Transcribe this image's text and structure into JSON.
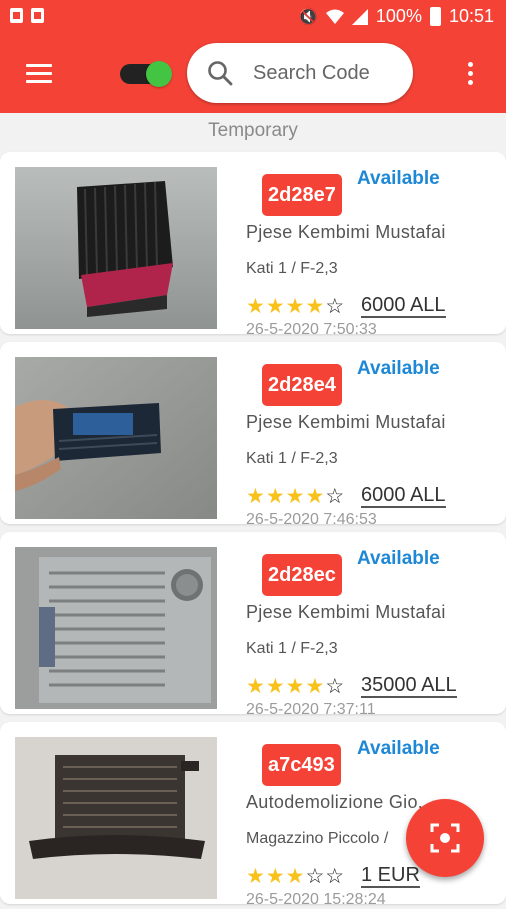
{
  "status_bar": {
    "battery": "100%",
    "time": "10:51",
    "icons": [
      "notification-icon",
      "sim-card-icon",
      "mute-icon",
      "wifi-icon",
      "signal-icon",
      "battery-icon"
    ]
  },
  "app_bar": {
    "menu_icon": "hamburger-menu-icon",
    "toggle_on": true,
    "search": {
      "placeholder": "Search Code"
    },
    "more_icon": "more-vert-icon"
  },
  "section_label": "Temporary",
  "items": [
    {
      "code": "2d28e7",
      "status": "Available",
      "shop": "Pjese Kembimi Mustafai",
      "location": "Kati 1 / F-2,3",
      "rating": 4,
      "rating_max": 5,
      "rating_text": "★★★★☆",
      "price": "6000 ALL",
      "date": "26-5-2020  7:50:33"
    },
    {
      "code": "2d28e4",
      "status": "Available",
      "shop": "Pjese Kembimi Mustafai",
      "location": "Kati 1 / F-2,3",
      "rating": 4,
      "rating_max": 5,
      "rating_text": "★★★★☆",
      "price": "6000 ALL",
      "date": "26-5-2020  7:46:53"
    },
    {
      "code": "2d28ec",
      "status": "Available",
      "shop": "Pjese Kembimi Mustafai",
      "location": "Kati 1 / F-2,3",
      "rating": 4,
      "rating_max": 5,
      "rating_text": "★★★★☆",
      "price": "35000 ALL",
      "date": "26-5-2020  7:37:11"
    },
    {
      "code": "a7c493",
      "status": "Available",
      "shop": "Autodemolizione Gio...",
      "location": "Magazzino Piccolo /",
      "rating": 3,
      "rating_max": 5,
      "rating_text": "★★★☆☆",
      "price": "1 EUR",
      "date": "26-5-2020  15:28:24"
    }
  ],
  "fab": {
    "icon": "scan-code-icon"
  },
  "colors": {
    "primary": "#f44336",
    "accent_blue": "#1e88d6",
    "star": "#f9c21b",
    "toggle": "#43c543"
  }
}
